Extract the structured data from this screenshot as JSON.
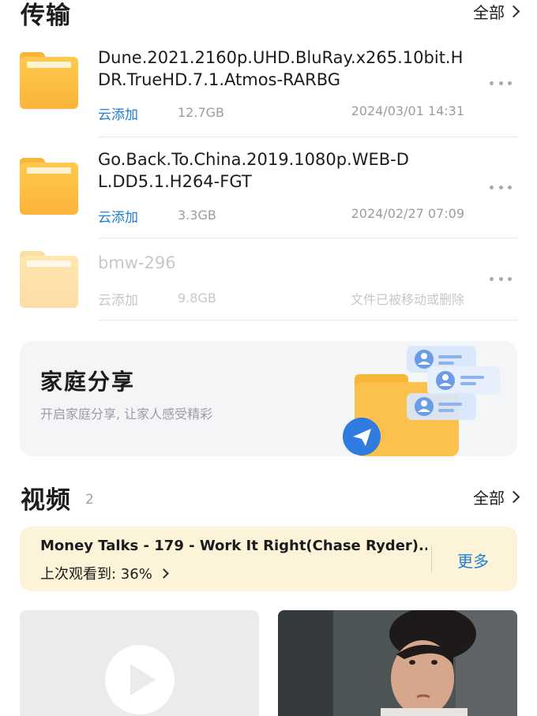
{
  "transfer_section": {
    "title": "传输",
    "see_all": "全部"
  },
  "files": [
    {
      "name": "Dune.2021.2160p.UHD.BluRay.x265.10bit.HDR.TrueHD.7.1.Atmos-RARBG",
      "source": "云添加",
      "size": "12.7GB",
      "date": "2024/03/01 14:31",
      "faded": false
    },
    {
      "name": "Go.Back.To.China.2019.1080p.WEB-DL.DD5.1.H264-FGT",
      "source": "云添加",
      "size": "3.3GB",
      "date": "2024/02/27 07:09",
      "faded": false
    },
    {
      "name": "bmw-296",
      "source": "云添加",
      "size": "9.8GB",
      "date": "文件已被移动或删除",
      "faded": true
    }
  ],
  "family_share": {
    "title": "家庭分享",
    "subtitle": "开启家庭分享, 让家人感受精彩"
  },
  "video_section": {
    "title": "视频",
    "count": "2",
    "see_all": "全部"
  },
  "resume": {
    "title": "Money Talks - 179 - Work It Right(Chase Ryder)...",
    "progress_label": "上次观看到: 36%",
    "more": "更多"
  },
  "colors": {
    "accent_blue": "#1f7fd2",
    "folder_yellow": "#fcb43a",
    "resume_bg": "#fdf3d8",
    "card_bg": "#f4f5f7"
  }
}
